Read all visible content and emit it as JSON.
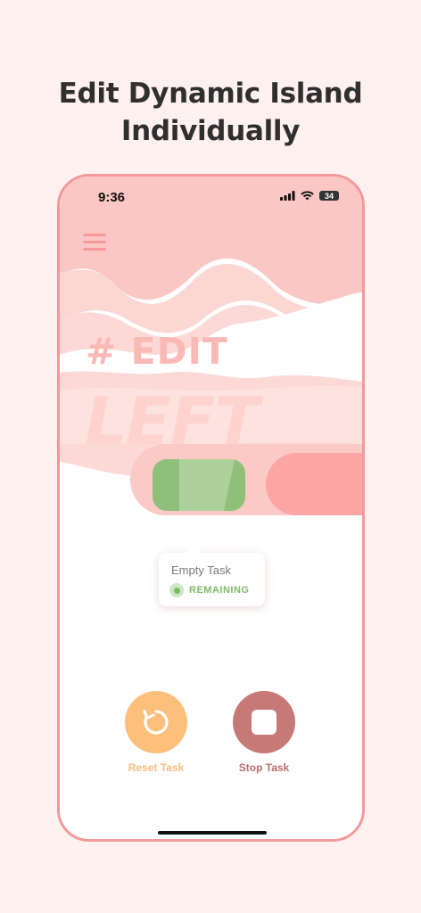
{
  "headline": {
    "line1": "Edit Dynamic Island",
    "line2": "Individually"
  },
  "status_bar": {
    "time": "9:36",
    "battery": "34"
  },
  "hero": {
    "tag": "# EDIT",
    "word": "LEFT"
  },
  "tooltip": {
    "title": "Empty Task",
    "status": "REMAINING"
  },
  "actions": {
    "reset_label": "Reset Task",
    "stop_label": "Stop Task"
  },
  "colors": {
    "accent": "#f2999b",
    "green": "#7dbb66",
    "reset": "#fdbf7c",
    "stop": "#c67a78"
  }
}
